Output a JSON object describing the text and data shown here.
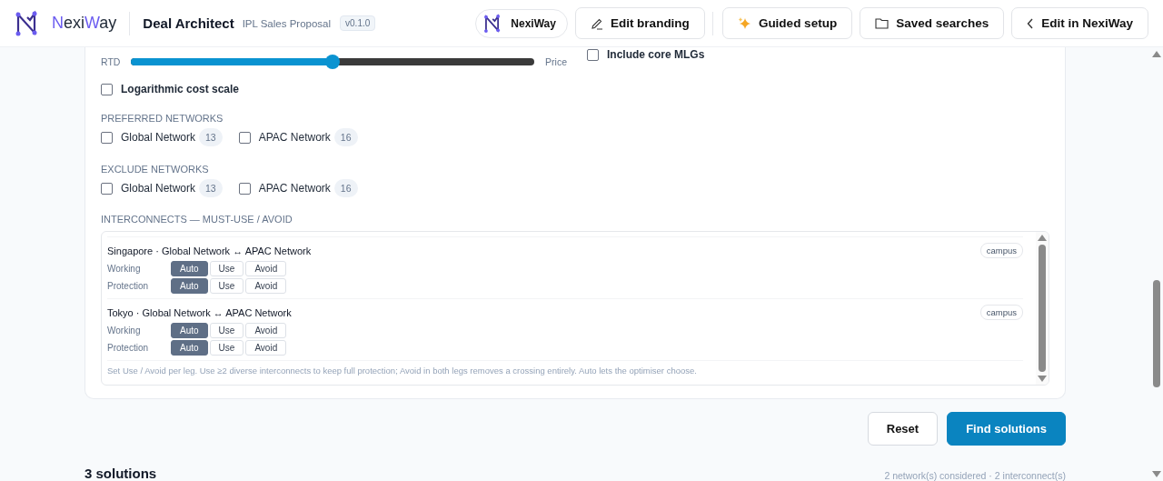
{
  "header": {
    "brand": [
      {
        "text": "N",
        "accent": true
      },
      {
        "text": "exi",
        "accent": false
      },
      {
        "text": "W",
        "accent": true
      },
      {
        "text": "ay",
        "accent": false
      }
    ],
    "app_title": "Deal Architect",
    "subtitle": "IPL Sales Proposal",
    "version": "v0.1.0",
    "org_chip": "NexiWay",
    "buttons": [
      {
        "kind": "pen",
        "label": "Edit branding"
      },
      {
        "kind": "sparkle",
        "label": "Guided setup"
      },
      {
        "kind": "folder",
        "label": "Saved searches"
      },
      {
        "kind": "back",
        "label": "Edit in NexiWay"
      }
    ]
  },
  "slider": {
    "left_label": "RTD",
    "right_label": "Price",
    "level": 0.5
  },
  "include_core": {
    "label": "Include core MLGs",
    "checked": false
  },
  "log_scale": {
    "label": "Logarithmic cost scale",
    "checked": false
  },
  "network_groups": [
    {
      "title": "PREFERRED NETWORKS",
      "items": [
        {
          "label": "Global Network",
          "count": "13",
          "checked": false
        },
        {
          "label": "APAC Network",
          "count": "16",
          "checked": false
        }
      ]
    },
    {
      "title": "EXCLUDE NETWORKS",
      "items": [
        {
          "label": "Global Network",
          "count": "13",
          "checked": false
        },
        {
          "label": "APAC Network",
          "count": "16",
          "checked": false
        }
      ]
    }
  ],
  "interconnects": {
    "title": "INTERCONNECTS — MUST-USE / AVOID",
    "items": [
      {
        "name": "Singapore · Global Network ↔ APAC Network",
        "tag": "campus",
        "legs": [
          {
            "label": "Working",
            "options": [
              {
                "label": "Auto",
                "selected": true
              },
              {
                "label": "Use",
                "selected": false
              },
              {
                "label": "Avoid",
                "selected": false
              }
            ]
          },
          {
            "label": "Protection",
            "options": [
              {
                "label": "Auto",
                "selected": true
              },
              {
                "label": "Use",
                "selected": false
              },
              {
                "label": "Avoid",
                "selected": false
              }
            ]
          }
        ]
      },
      {
        "name": "Tokyo · Global Network ↔ APAC Network",
        "tag": "campus",
        "legs": [
          {
            "label": "Working",
            "options": [
              {
                "label": "Auto",
                "selected": true
              },
              {
                "label": "Use",
                "selected": false
              },
              {
                "label": "Avoid",
                "selected": false
              }
            ]
          },
          {
            "label": "Protection",
            "options": [
              {
                "label": "Auto",
                "selected": true
              },
              {
                "label": "Use",
                "selected": false
              },
              {
                "label": "Avoid",
                "selected": false
              }
            ]
          }
        ]
      }
    ],
    "note": "Set Use / Avoid per leg. Use ≥2 diverse interconnects to keep full protection; Avoid in both legs removes a crossing entirely. Auto lets the optimiser choose."
  },
  "actions": [
    {
      "kind": "secondary",
      "label": "Reset"
    },
    {
      "kind": "primary",
      "label": "Find solutions"
    }
  ],
  "results": {
    "title": "3 solutions",
    "summary": "2 network(s) considered · 2 interconnect(s)"
  }
}
